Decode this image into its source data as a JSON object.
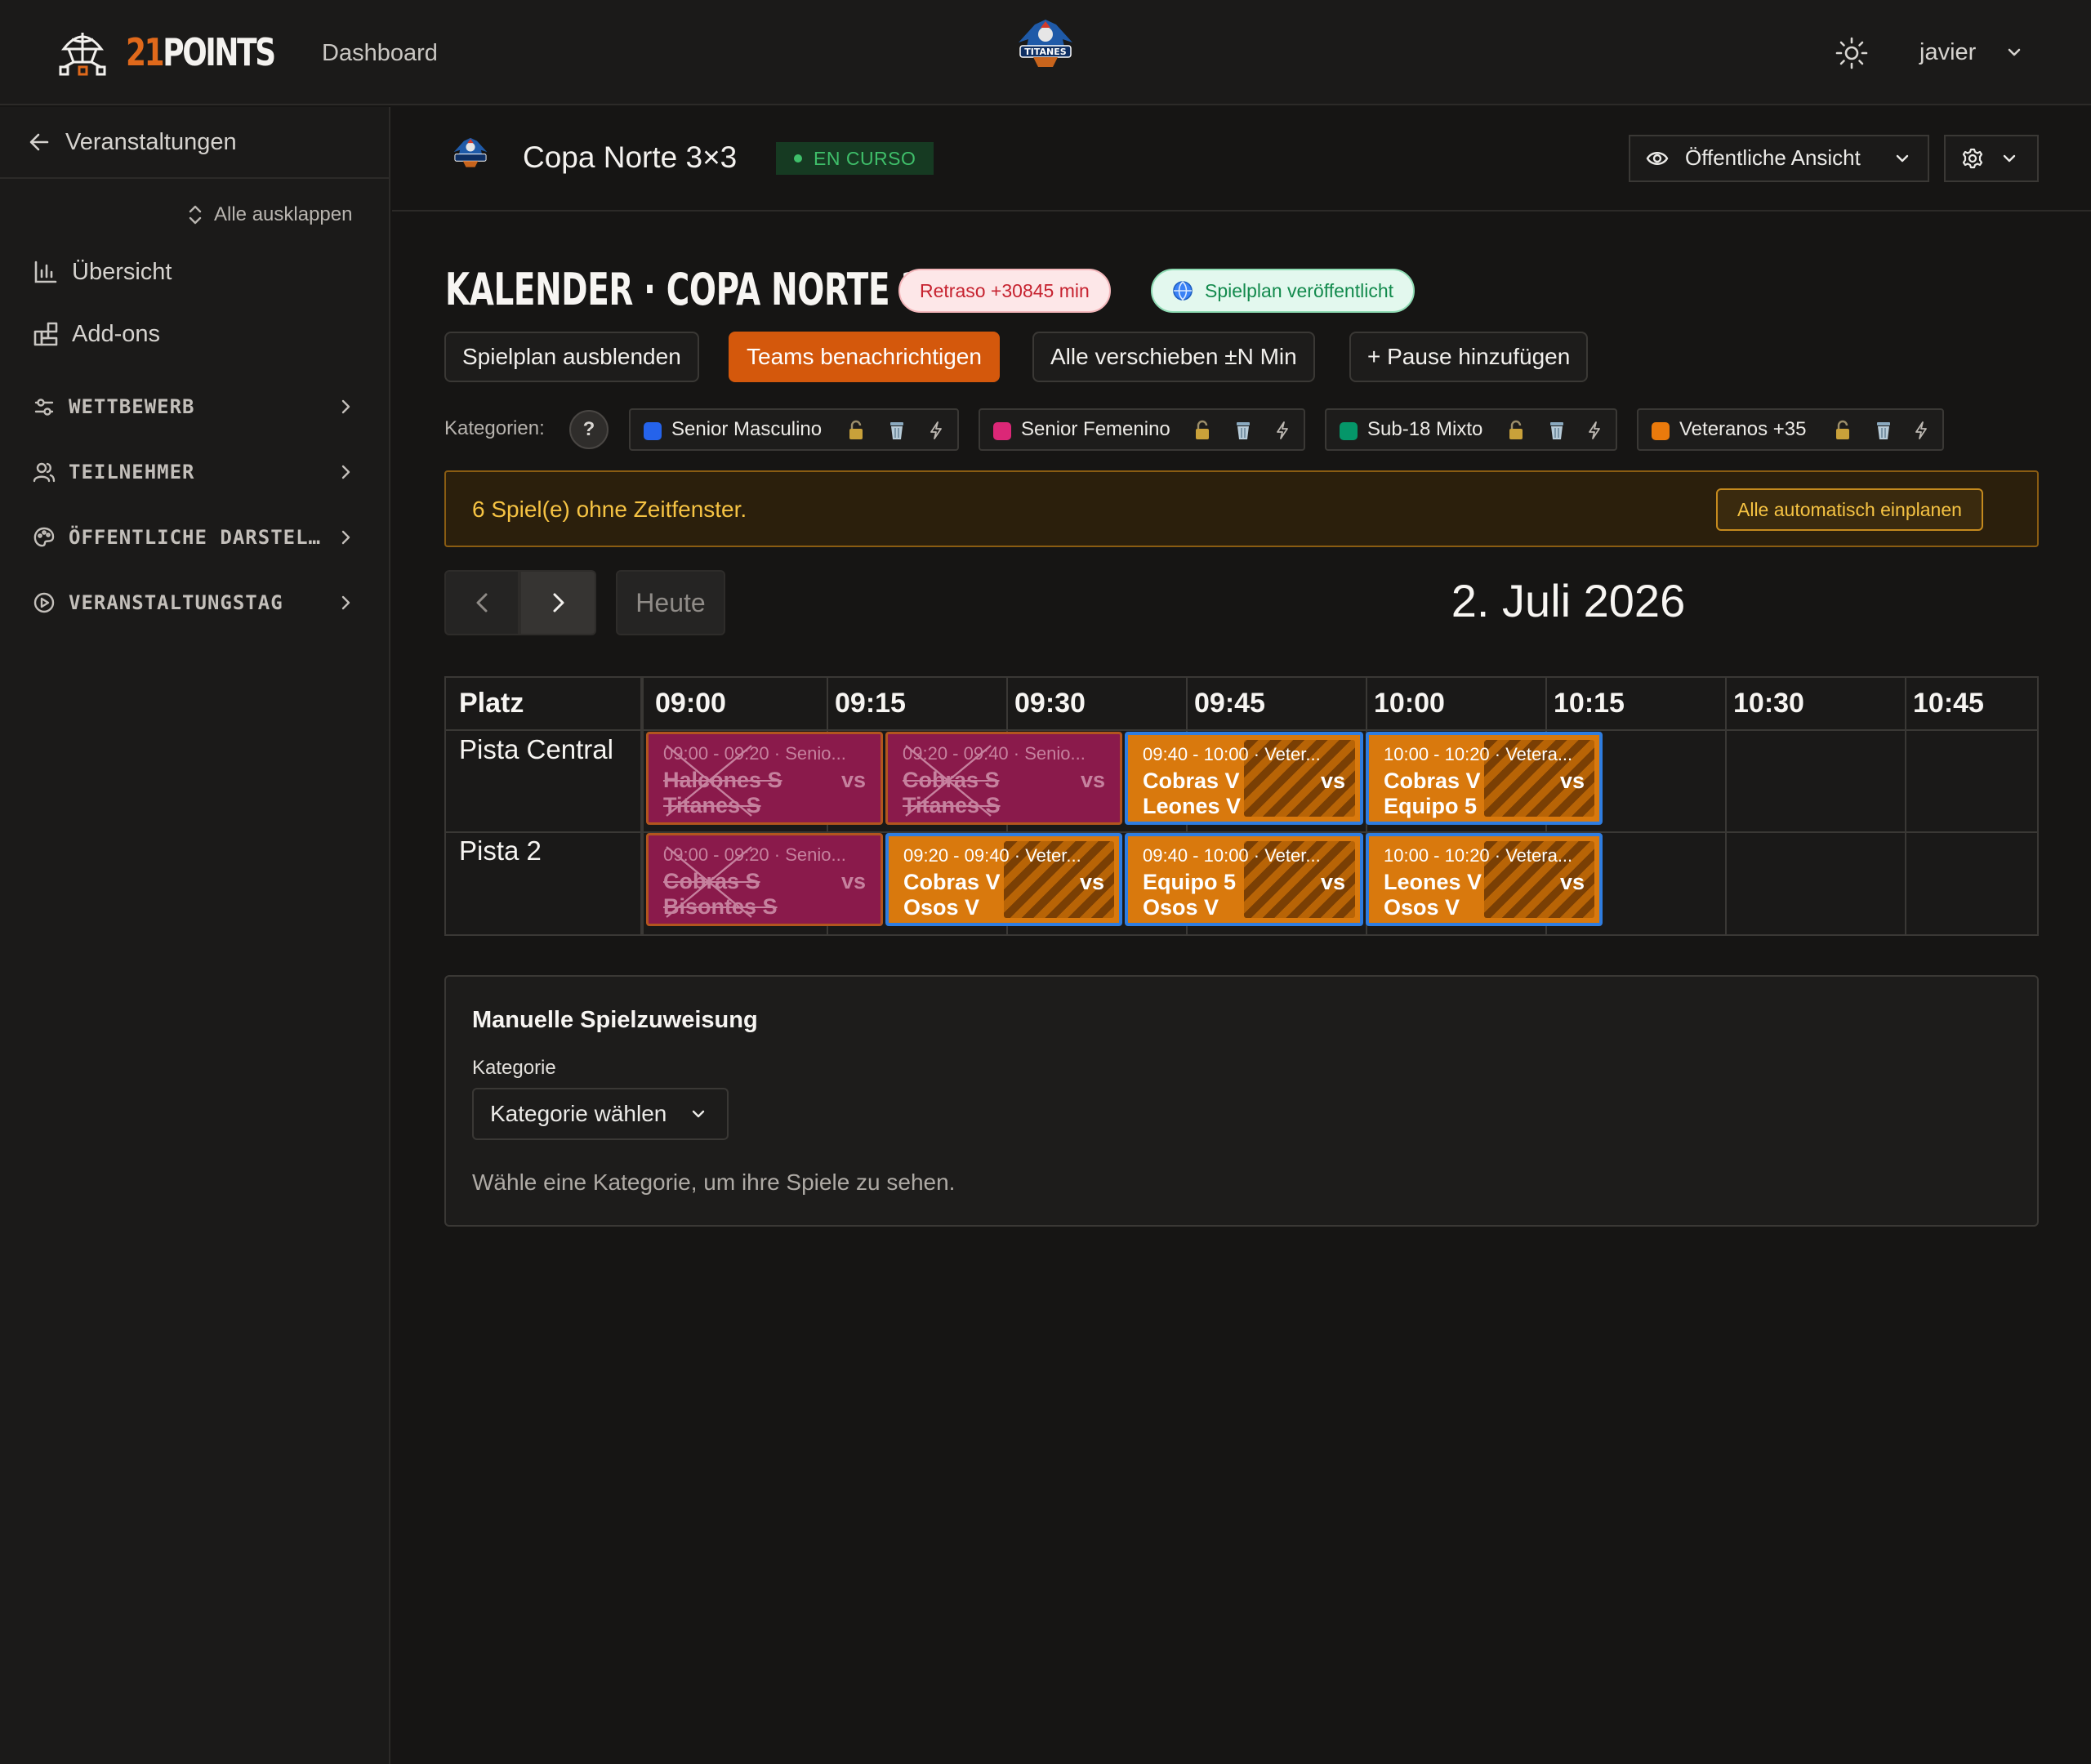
{
  "brand": {
    "logo_num": "21",
    "logo_word": "POINTS"
  },
  "topbar": {
    "nav_dashboard": "Dashboard",
    "user_name": "javier",
    "team_logo": "Titanes team crest"
  },
  "sidebar": {
    "back_label": "Veranstaltungen",
    "expand_label": "Alle ausklappen",
    "items": [
      {
        "label": "Übersicht",
        "icon": "bar-chart-icon"
      },
      {
        "label": "Add-ons",
        "icon": "puzzle-icon"
      }
    ],
    "sections": [
      {
        "label": "WETTBEWERB",
        "icon": "sliders-icon"
      },
      {
        "label": "TEILNEHMER",
        "icon": "users-icon"
      },
      {
        "label": "ÖFFENTLICHE DARSTEL…",
        "icon": "palette-icon"
      },
      {
        "label": "VERANSTALTUNGSTAG",
        "icon": "play-circle-icon"
      }
    ]
  },
  "event": {
    "title": "Copa Norte 3×3",
    "status": "EN CURSO",
    "public_view_label": "Öffentliche Ansicht"
  },
  "calendar": {
    "title": "KALENDER · COPA NORTE 3X3",
    "delay_badge": "Retraso +30845 min",
    "published_badge": "Spielplan veröffentlicht",
    "actions": [
      "Spielplan ausblenden",
      "Teams benachrichtigen",
      "Alle verschieben ±N Min",
      "+ Pause hinzufügen"
    ],
    "categories_label": "Kategorien:",
    "help": "?",
    "categories": [
      {
        "name": "Senior Masculino",
        "color": "#2563eb"
      },
      {
        "name": "Senior Femenino",
        "color": "#db2777"
      },
      {
        "name": "Sub-18 Mixto",
        "color": "#059669"
      },
      {
        "name": "Veteranos +35",
        "color": "#ea7a0c"
      }
    ],
    "warning_text": "6 Spiel(e) ohne Zeitfenster.",
    "warning_button": "Alle automatisch einplanen",
    "today_label": "Heute",
    "date": "2. Juli 2026",
    "col_header": "Platz",
    "times": [
      "09:00",
      "09:15",
      "09:30",
      "09:45",
      "10:00",
      "10:15",
      "10:30",
      "10:45"
    ],
    "courts": [
      "Pista Central",
      "Pista 2"
    ],
    "matches": [
      {
        "time": "09:00 - 09:20 · Senio...",
        "team1": "Halcones S",
        "team2": "Titanes S",
        "vs": "vs",
        "status": "cancelled"
      },
      {
        "time": "09:20 - 09:40 · Senio...",
        "team1": "Cobras S",
        "team2": "Titanes S",
        "vs": "vs",
        "status": "cancelled"
      },
      {
        "time": "09:40 - 10:00 · Veter...",
        "team1": "Cobras V",
        "team2": "Leones V",
        "vs": "vs",
        "status": "scheduled"
      },
      {
        "time": "10:00 - 10:20 · Vetera...",
        "team1": "Cobras V",
        "team2": "Equipo 5",
        "vs": "vs",
        "status": "scheduled"
      },
      {
        "time": "09:00 - 09:20 · Senio...",
        "team1": "Cobras S",
        "team2": "Bisontes S",
        "vs": "vs",
        "status": "cancelled"
      },
      {
        "time": "09:20 - 09:40 · Veter...",
        "team1": "Cobras V",
        "team2": "Osos V",
        "vs": "vs",
        "status": "scheduled"
      },
      {
        "time": "09:40 - 10:00 · Veter...",
        "team1": "Equipo 5",
        "team2": "Osos V",
        "vs": "vs",
        "status": "scheduled"
      },
      {
        "time": "10:00 - 10:20 · Vetera...",
        "team1": "Leones V",
        "team2": "Osos V",
        "vs": "vs",
        "status": "scheduled"
      }
    ]
  },
  "manual": {
    "title": "Manuelle Spielzuweisung",
    "category_label": "Kategorie",
    "select_placeholder": "Kategorie wählen",
    "hint": "Wähle eine Kategorie, um ihre Spiele zu sehen."
  },
  "colors": {
    "accent": "#d4580c",
    "senior_match": "#8a1a4b",
    "veteran_match": "#d9790d",
    "selected_border": "#2f7de0",
    "status_green": "#3fbf6a"
  }
}
